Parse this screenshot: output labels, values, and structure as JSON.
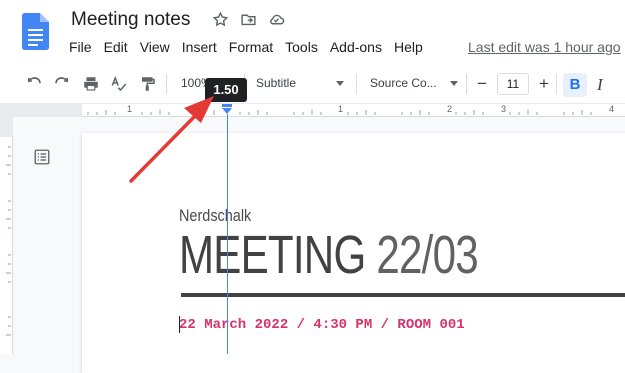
{
  "doc": {
    "title": "Meeting notes",
    "last_edit": "Last edit was 1 hour ago"
  },
  "menu": [
    "File",
    "Edit",
    "View",
    "Insert",
    "Format",
    "Tools",
    "Add-ons",
    "Help"
  ],
  "toolbar": {
    "zoom": "100%",
    "style": "Subtitle",
    "font": "Source Co...",
    "font_size": "11",
    "minus": "−",
    "plus": "+",
    "bold": "B",
    "italic": "I"
  },
  "tooltip": "1.50",
  "ruler": {
    "marks": [
      "1",
      "1",
      "2",
      "3",
      "4"
    ]
  },
  "content": {
    "subtitle": "Nerdschalk",
    "heading_main": "MEETING ",
    "heading_num": "22/03",
    "dateline": "22 March 2022 / 4:30 PM / ROOM 001"
  },
  "colors": {
    "accent": "#1a73e8",
    "guide": "#4285f4",
    "arrow": "#e53935",
    "dateline": "#d6336c"
  }
}
